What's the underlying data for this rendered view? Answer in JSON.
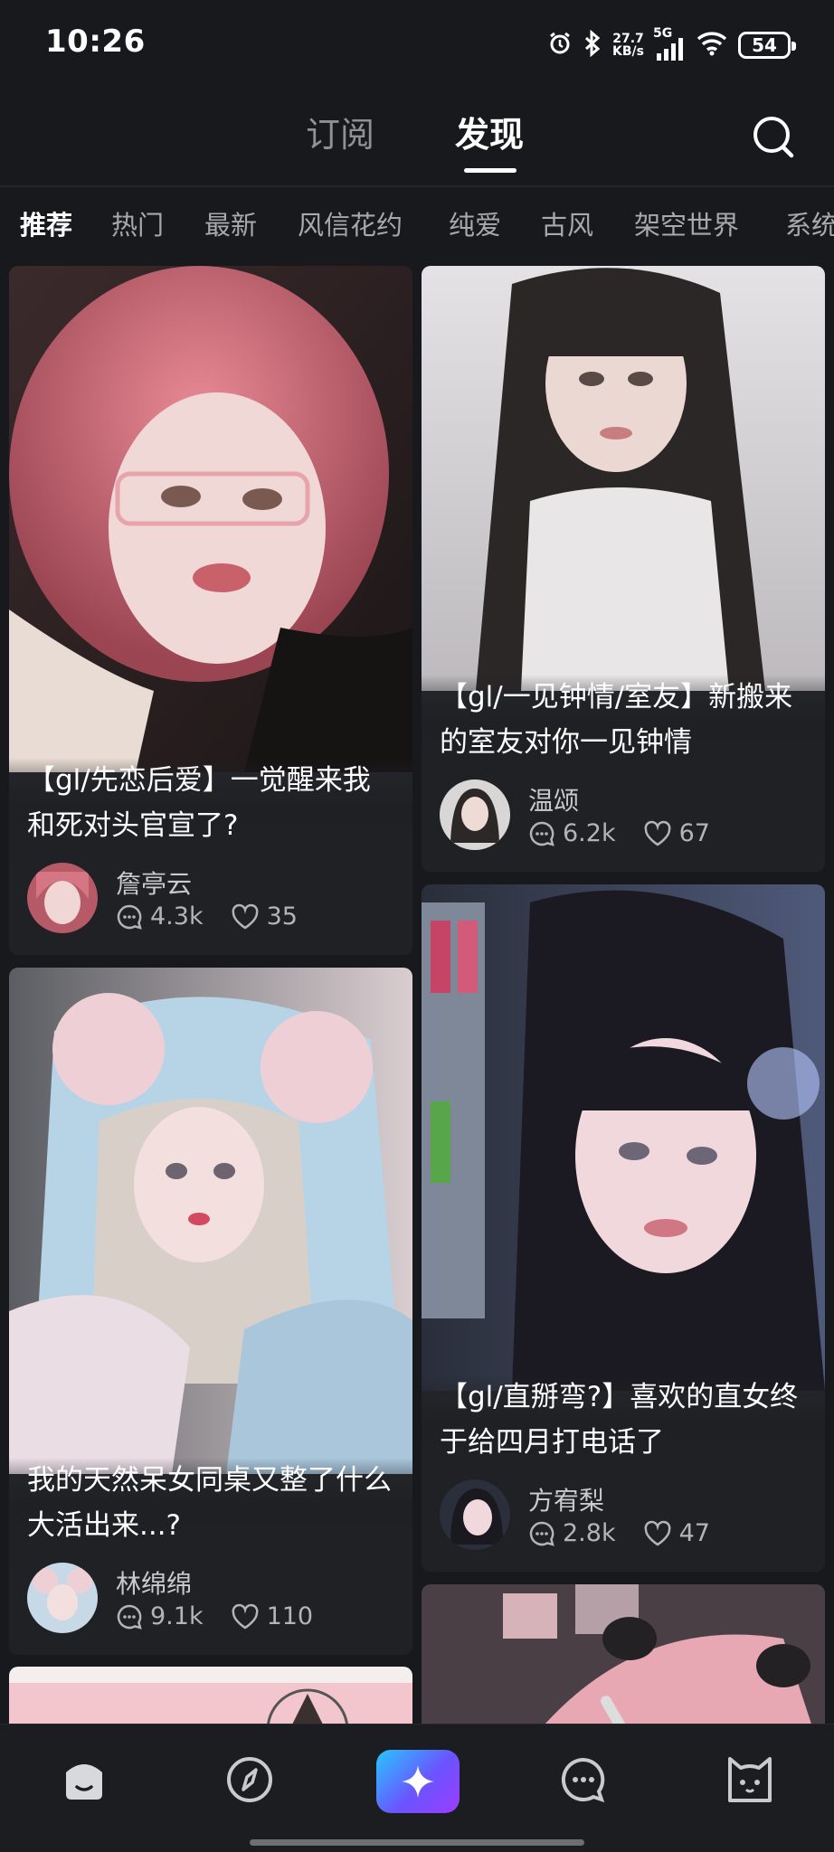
{
  "status_bar": {
    "time": "10:26",
    "net_speed_value": "27.7",
    "net_speed_unit": "KB/s",
    "network": "5G",
    "battery": "54"
  },
  "header": {
    "tabs": [
      {
        "label": "订阅",
        "active": false
      },
      {
        "label": "发现",
        "active": true
      }
    ],
    "search_icon": "search-icon"
  },
  "categories": [
    "推荐",
    "热门",
    "最新",
    "风信花约",
    "纯爱",
    "古风",
    "架空世界",
    "系统"
  ],
  "active_category": "推荐",
  "feed": {
    "cards": [
      {
        "title": "【gl/先恋后爱】一觉醒来我和死对头官宣了?",
        "author": "詹亭云",
        "comments": "4.3k",
        "likes": "35"
      },
      {
        "title": "【gl/一见钟情/室友】新搬来的室友对你一见钟情",
        "author": "温颂",
        "comments": "6.2k",
        "likes": "67"
      },
      {
        "title": "我的天然呆女同桌又整了什么大活出来...?",
        "author": "林绵绵",
        "comments": "9.1k",
        "likes": "110"
      },
      {
        "title": "【gl/直掰弯?】喜欢的直女终于给四月打电话了",
        "author": "方宥梨",
        "comments": "2.8k",
        "likes": "47"
      }
    ]
  },
  "bottom_nav": {
    "items": [
      "home-icon",
      "compass-icon",
      "sparkle-create-icon",
      "chat-icon",
      "cat-profile-icon"
    ],
    "accent_gradient": [
      "#27c6ff",
      "#6a54ff",
      "#9b3cff"
    ]
  },
  "colors": {
    "background": "#17191d",
    "card": "#25272c",
    "text_secondary": "#a7a9ad"
  }
}
